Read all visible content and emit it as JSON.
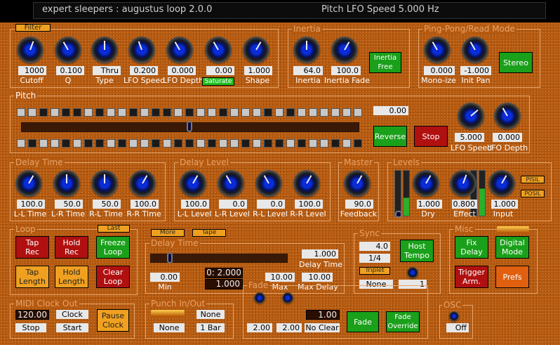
{
  "title": "expert sleepers : augustus loop 2.0.0",
  "status": "Pitch LFO Speed   5.000  Hz",
  "filter": {
    "button": "Filter",
    "cutoff": "1000",
    "q": "0.100",
    "type": "Thru",
    "lfo_speed": "0.200",
    "lfo_depth": "0.000",
    "saturate_val": "0.00",
    "saturate": "Saturate",
    "shape": "1.000",
    "l_cutoff": "Cutoff",
    "l_q": "Q",
    "l_type": "Type",
    "l_lfospeed": "LFO Speed",
    "l_lfodepth": "LFO Depth",
    "l_shape": "Shape"
  },
  "inertia": {
    "title": "Inertia",
    "inertia": "64.0",
    "fade": "100.0",
    "free": "Inertia\nFree",
    "l_inertia": "Inertia",
    "l_fade": "Inertia Fade"
  },
  "pingpong": {
    "title": "Ping-Pong/Read Mode",
    "mono": "0.000",
    "initpan": "-1.000",
    "stereo": "Stereo",
    "l_mono": "Mono-ize",
    "l_initpan": "Init Pan"
  },
  "pitch": {
    "title": "Pitch",
    "value": "0.00",
    "reverse": "Reverse",
    "stop": "Stop",
    "lfo_speed": "5.000",
    "lfo_depth": "0.000",
    "l_lfospeed": "LFO Speed",
    "l_lfodepth": "LFO Depth",
    "top_row": [
      1,
      1,
      0,
      1,
      0,
      0,
      1,
      0,
      1,
      1,
      0,
      1,
      0,
      0,
      1,
      0,
      1,
      1,
      0,
      1,
      1,
      1,
      0,
      1,
      0,
      1,
      1,
      1,
      1,
      1,
      1
    ],
    "bottom_row": [
      1,
      0,
      1,
      1,
      0,
      1,
      0,
      0,
      1,
      0,
      1,
      1,
      0,
      1,
      0,
      0,
      1,
      0,
      1,
      1,
      0,
      1,
      0,
      0,
      1,
      0,
      1,
      1,
      0,
      1,
      0
    ]
  },
  "delaytime": {
    "title": "Delay Time",
    "ll": "100.0",
    "lr": "50.0",
    "rl": "50.0",
    "rr": "100.0",
    "l_ll": "L-L Time",
    "l_lr": "L-R Time",
    "l_rl": "R-L Time",
    "l_rr": "R-R Time"
  },
  "delaylevel": {
    "title": "Delay Level",
    "ll": "100.0",
    "lr": "0.0",
    "rl": "0.0",
    "rr": "100.0",
    "l_ll": "L-L Level",
    "l_lr": "L-R Level",
    "l_rl": "R-L Level",
    "l_rr": "R-R Level"
  },
  "master": {
    "title": "Master",
    "feedback": "90.0",
    "l_feedback": "Feedback"
  },
  "levels": {
    "title": "Levels",
    "dry": "1.000",
    "effect": "0.800",
    "input": "1.000",
    "l_dry": "Dry",
    "l_effect": "Effect",
    "l_input": "Input",
    "pisil": "PISIL",
    "posil": "POSIL"
  },
  "loop": {
    "title": "Loop",
    "last": "Last",
    "tap_rec": "Tap\nRec",
    "hold_rec": "Hold\nRec",
    "freeze": "Freeze\nLoop",
    "tap_len": "Tap\nLength",
    "hold_len": "Hold\nLength",
    "clear": "Clear\nLoop"
  },
  "delay2": {
    "title": "Delay Time",
    "more": "More",
    "tape": "Tape",
    "min": "0.00",
    "time": "0: 2.000",
    "mult": "1.000",
    "max": "10.00",
    "delaytime": "1.000",
    "maxdelay": "10.00",
    "l_min": "Min",
    "l_max": "Max",
    "l_delaytime": "Delay Time",
    "l_maxdelay": "Max Delay"
  },
  "sync": {
    "title": "Sync",
    "v1": "4.0",
    "v2": "1/4",
    "triplet": "Triplet",
    "none": "None",
    "host": "Host\nTempo",
    "v3": "1"
  },
  "misc": {
    "title": "Misc",
    "fix": "Fix\nDelay",
    "digital": "Digital\nMode",
    "trigger": "Trigger\nArm.",
    "prefs": "Prefs"
  },
  "midi": {
    "title": "MIDI Clock Out",
    "bpm": "120.00",
    "clock": "Clock",
    "stop": "Stop",
    "start": "Start",
    "pause": "Pause\nClock"
  },
  "punch": {
    "title": "Punch In/Out",
    "none1": "None",
    "none2": "None",
    "bar": "1 Bar"
  },
  "fade": {
    "title": "Fade",
    "v1": "2.00",
    "v2": "2.00",
    "v3": "1.00",
    "noclear": "No Clear",
    "fade": "Fade",
    "override": "Fade\nOverride"
  },
  "osc": {
    "title": "OSC",
    "off": "Off"
  }
}
